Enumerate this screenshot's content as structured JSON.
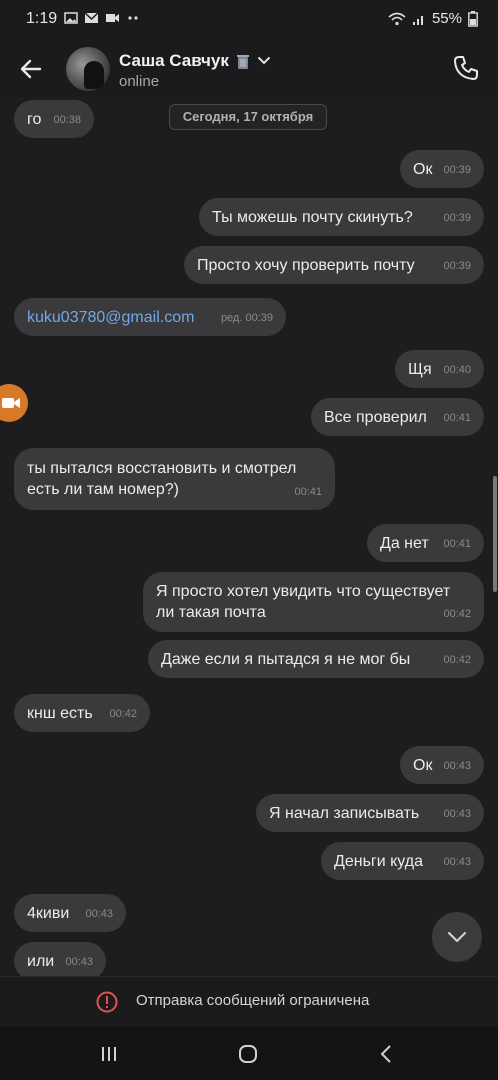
{
  "status_bar": {
    "time": "1:19",
    "battery": "55%",
    "icons": [
      "gallery-icon",
      "mail-icon",
      "video-icon",
      "more-dots-icon",
      "wifi-icon",
      "signal-icon",
      "battery-icon"
    ]
  },
  "header": {
    "name": "Саша Савчук",
    "status": "online"
  },
  "chat": {
    "date_divider": "Сегодня, 17 октября",
    "messages": [
      {
        "text": "го",
        "time": "00:38",
        "side": "in"
      },
      {
        "text": "Ок",
        "time": "00:39",
        "side": "out"
      },
      {
        "text": "Ты можешь почту скинуть?",
        "time": "00:39",
        "side": "out"
      },
      {
        "text": "Просто хочу проверить почту",
        "time": "00:39",
        "side": "out"
      },
      {
        "text": "kuku03780@gmail.com",
        "time": "ред. 00:39",
        "side": "in"
      },
      {
        "text": "Щя",
        "time": "00:40",
        "side": "out"
      },
      {
        "text": "Все проверил",
        "time": "00:41",
        "side": "out"
      },
      {
        "line1": "ты пытался восстановить и смотрел",
        "line2": "есть ли там номер?)",
        "time": "00:41",
        "side": "in"
      },
      {
        "text": "Да нет",
        "time": "00:41",
        "side": "out"
      },
      {
        "line1": "Я просто хотел увидить что существует",
        "line2": "ли такая почта",
        "time": "00:42",
        "side": "out"
      },
      {
        "text": "Даже если я пытадся я не мог бы",
        "time": "00:42",
        "side": "out"
      },
      {
        "text": "кнш есть",
        "time": "00:42",
        "side": "in"
      },
      {
        "text": "Ок",
        "time": "00:43",
        "side": "out"
      },
      {
        "text": "Я начал записывать",
        "time": "00:43",
        "side": "out"
      },
      {
        "text": "Деньги куда",
        "time": "00:43",
        "side": "out"
      },
      {
        "text": "4киви",
        "time": "00:43",
        "side": "in"
      },
      {
        "text": "или",
        "time": "00:43",
        "side": "in"
      }
    ]
  },
  "footer": {
    "restricted_text": "Отправка сообщений ограничена"
  },
  "colors": {
    "background": "#1d1d1f",
    "bubble": "#3a3a3c",
    "link": "#71a7ea",
    "warning": "#e05252",
    "camera_button": "#d8792a"
  }
}
